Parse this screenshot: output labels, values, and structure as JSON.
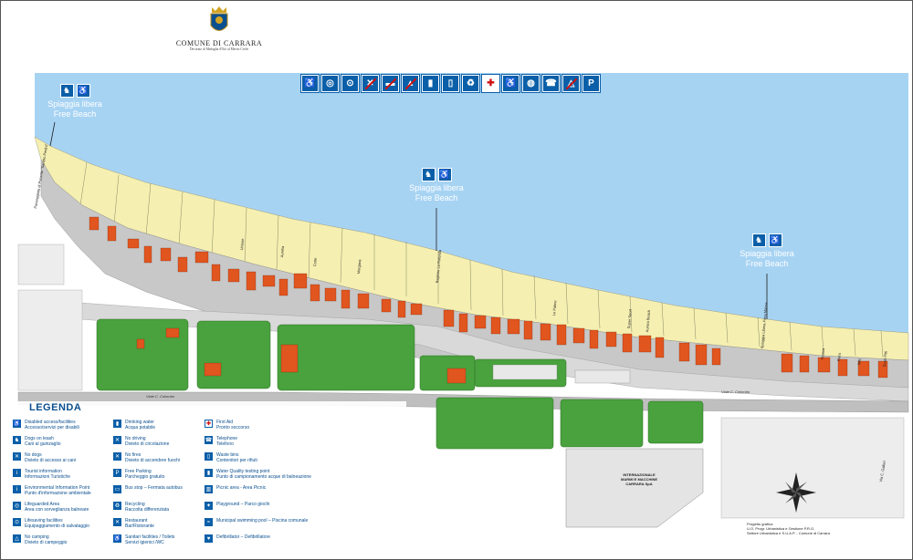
{
  "header": {
    "town": "COMUNE DI CARRARA",
    "motto": "Decorato di Medaglia d'Oro al Merito Civile"
  },
  "colors": {
    "sea": "#a7d3f3",
    "sand": "#f5efb1",
    "parcel": "#c8c8c8",
    "building": "#e1551f",
    "green": "#49a23d",
    "service_blue": "#0a5fa8",
    "first_aid_red": "#d01010"
  },
  "service_icons": [
    {
      "icon": "wheelchair-icon",
      "glyph": "♿",
      "style": "blue"
    },
    {
      "icon": "lifeguard-icon",
      "glyph": "◎",
      "style": "blue"
    },
    {
      "icon": "lifebuoy-icon",
      "glyph": "⊙",
      "style": "blue"
    },
    {
      "icon": "no-dogs-icon",
      "glyph": "✕",
      "style": "strike"
    },
    {
      "icon": "no-driving-icon",
      "glyph": "▬",
      "style": "strike"
    },
    {
      "icon": "no-fires-icon",
      "glyph": "▲",
      "style": "strike"
    },
    {
      "icon": "drinking-water-icon",
      "glyph": "▮",
      "style": "blue"
    },
    {
      "icon": "waste-bin-icon",
      "glyph": "▯",
      "style": "blue"
    },
    {
      "icon": "recycling-icon",
      "glyph": "♻",
      "style": "blue"
    },
    {
      "icon": "first-aid-icon",
      "glyph": "✚",
      "style": "red"
    },
    {
      "icon": "toilets-icon",
      "glyph": "♿",
      "style": "blue"
    },
    {
      "icon": "showers-icon",
      "glyph": "◍",
      "style": "blue"
    },
    {
      "icon": "telephone-icon",
      "glyph": "☎",
      "style": "blue"
    },
    {
      "icon": "no-camping-icon",
      "glyph": "△",
      "style": "strike"
    },
    {
      "icon": "parking-icon",
      "glyph": "P",
      "style": "blue"
    }
  ],
  "free_beaches": [
    {
      "line1": "Spiaggia libera",
      "line2": "Free Beach"
    },
    {
      "line1": "Spiaggia libera",
      "line2": "Free Beach"
    },
    {
      "line1": "Spiaggia libera",
      "line2": "Free Beach"
    }
  ],
  "streets": {
    "viale_colombo_1": "Viale C. Colombo",
    "viale_colombo_2": "Viale C. Colombo",
    "passeggiata": "Passeggiata di Ponente \"Sandro Pertini\"",
    "via_galleri": "Via C. Galleri"
  },
  "beach_names": [
    "Unione",
    "Aurelia",
    "Corte",
    "Morgana",
    "Bagnino La Rotonda",
    "Le Palme",
    "Super Sport",
    "Aurora Beach",
    "Spiaggia Libera Fiera Massa",
    "Franca",
    "Flora",
    "Italy",
    "Scalo Fitti"
  ],
  "industrial": {
    "line1": "INTERNAZIONALE",
    "line2": "MARMI E MACCHINE",
    "line3": "CARRARA SpA"
  },
  "legend": {
    "title": "LEGENDA",
    "items": [
      {
        "icon": "wheelchair-icon",
        "glyph": "♿",
        "en": "Disabled access/facilities",
        "it": "Accesso/servizi per disabili"
      },
      {
        "icon": "dog-icon",
        "glyph": "♞",
        "en": "Dogs on leash",
        "it": "Cani al guinzaglio"
      },
      {
        "icon": "no-dogs-icon",
        "glyph": "✕",
        "en": "No dogs",
        "it": "Divieto di accesso ai cani"
      },
      {
        "icon": "info-icon",
        "glyph": "i",
        "en": "Tourist information",
        "it": "Informazioni Turistiche"
      },
      {
        "icon": "environment-info-icon",
        "glyph": "i",
        "en": "Environmental Information Point",
        "it": "Punto d'informazione ambientale"
      },
      {
        "icon": "lifeguard-icon",
        "glyph": "◎",
        "en": "Lifeguarded Area",
        "it": "Area con sorveglianza balneare"
      },
      {
        "icon": "lifebuoy-icon",
        "glyph": "⊙",
        "en": "Lifesaving facilities",
        "it": "Equipaggiamento di salvataggio"
      },
      {
        "icon": "no-camping-icon",
        "glyph": "△",
        "en": "No camping",
        "it": "Divieto di campeggio"
      },
      {
        "icon": "drinking-water-icon",
        "glyph": "▮",
        "en": "Drinking water",
        "it": "Acqua potabile"
      },
      {
        "icon": "no-driving-icon",
        "glyph": "✕",
        "en": "No driving",
        "it": "Divieto di circolazione"
      },
      {
        "icon": "no-fires-icon",
        "glyph": "✕",
        "en": "No fires",
        "it": "Divieto di accendere fuochi"
      },
      {
        "icon": "parking-icon",
        "glyph": "P",
        "en": "Free Parking",
        "it": "Parcheggio gratuito"
      },
      {
        "icon": "bus-stop-icon",
        "glyph": "▭",
        "en": "Bus stop – Fermata autobus",
        "it": ""
      },
      {
        "icon": "recycling-icon",
        "glyph": "♻",
        "en": "Recycling",
        "it": "Raccolta differenziata"
      },
      {
        "icon": "restaurant-icon",
        "glyph": "✕",
        "en": "Restaurant",
        "it": "Bar/Ristorante"
      },
      {
        "icon": "toilets-icon",
        "glyph": "♿",
        "en": "Sanitari facilities / Toilets",
        "it": "Servizi igienici /WC"
      },
      {
        "icon": "first-aid-icon",
        "glyph": "✚",
        "en": "First Aid",
        "it": "Pronto soccorso"
      },
      {
        "icon": "telephone-icon",
        "glyph": "☎",
        "en": "Telephone",
        "it": "Telefono"
      },
      {
        "icon": "waste-bin-icon",
        "glyph": "▯",
        "en": "Waste bins",
        "it": "Contenitori per rifiuti"
      },
      {
        "icon": "water-quality-icon",
        "glyph": "▮",
        "en": "Water Quality testing point",
        "it": "Punto di campionamento acque di balneazione"
      },
      {
        "icon": "picnic-icon",
        "glyph": "▥",
        "en": "Picnic area - Area Picnic",
        "it": ""
      },
      {
        "icon": "playground-icon",
        "glyph": "✦",
        "en": "Playground – Parco giochi",
        "it": ""
      },
      {
        "icon": "swimming-pool-icon",
        "glyph": "≈",
        "en": "Municipal swimming pool – Piscina comunale",
        "it": ""
      },
      {
        "icon": "defibrillator-icon",
        "glyph": "♥",
        "en": "Defibrillator – Defibrillatore",
        "it": ""
      }
    ]
  },
  "credits": {
    "line1": "Progetto grafico:",
    "line2": "U.O. Progr. Urbanistica e Gestione P.R.G.",
    "line3": "Settore Urbanistica e S.U.A.P. - Comune di Carrara"
  }
}
